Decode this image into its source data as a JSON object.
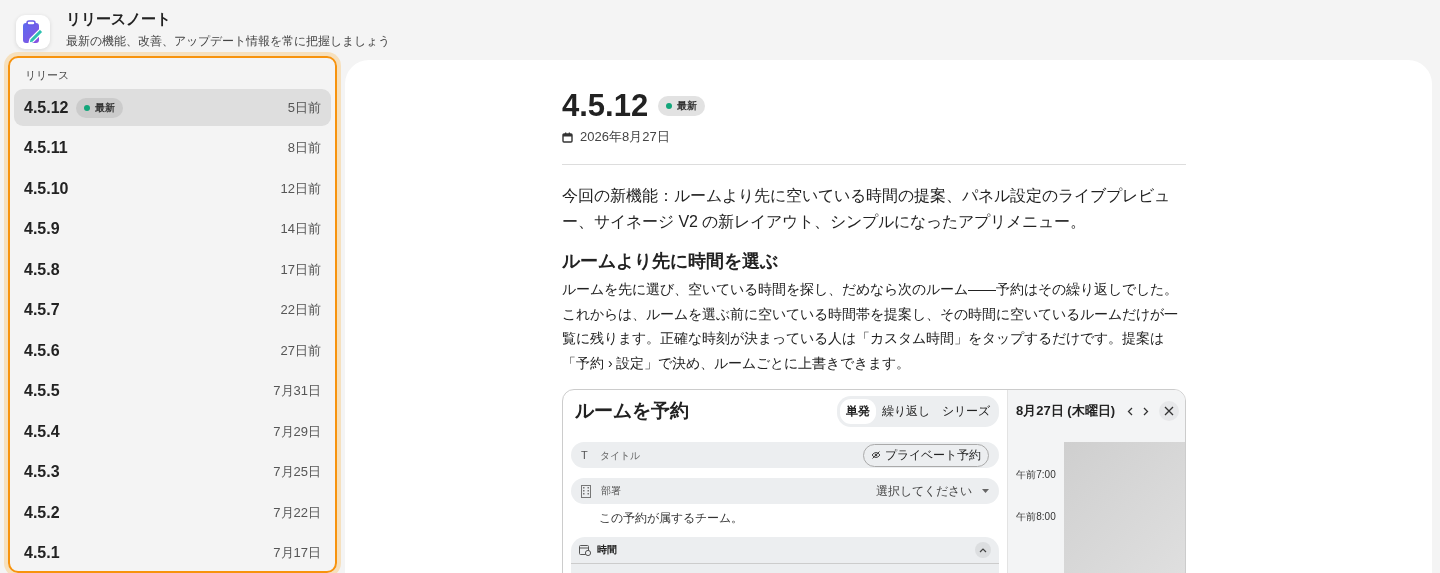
{
  "app": {
    "title": "リリースノート",
    "subtitle": "最新の機能、改善、アップデート情報を常に把握しましょう"
  },
  "sidebar": {
    "heading": "リリース",
    "releases": [
      {
        "version": "4.5.12",
        "badge": "最新",
        "date": "5日前",
        "selected": true
      },
      {
        "version": "4.5.11",
        "date": "8日前",
        "selected": false
      },
      {
        "version": "4.5.10",
        "date": "12日前",
        "selected": false
      },
      {
        "version": "4.5.9",
        "date": "14日前",
        "selected": false
      },
      {
        "version": "4.5.8",
        "date": "17日前",
        "selected": false
      },
      {
        "version": "4.5.7",
        "date": "22日前",
        "selected": false
      },
      {
        "version": "4.5.6",
        "date": "27日前",
        "selected": false
      },
      {
        "version": "4.5.5",
        "date": "7月31日",
        "selected": false
      },
      {
        "version": "4.5.4",
        "date": "7月29日",
        "selected": false
      },
      {
        "version": "4.5.3",
        "date": "7月25日",
        "selected": false
      },
      {
        "version": "4.5.2",
        "date": "7月22日",
        "selected": false
      },
      {
        "version": "4.5.1",
        "date": "7月17日",
        "selected": false
      }
    ]
  },
  "article": {
    "version": "4.5.12",
    "badge": "最新",
    "date": "2026年8月27日",
    "intro": "今回の新機能：ルームより先に空いている時間の提案、パネル設定のライブプレビュー、サイネージ V2 の新レイアウト、シンプルになったアプリメニュー。",
    "sections": [
      {
        "heading": "ルームより先に時間を選ぶ",
        "body": "ルームを先に選び、空いている時間を探し、だめなら次のルーム——予約はその繰り返しでした。これからは、ルームを選ぶ前に空いている時間帯を提案し、その時間に空いているルームだけが一覧に残ります。正確な時刻が決まっている人は「カスタム時間」をタップするだけです。提案は「予約 › 設定」で決め、ルームごとに上書きできます。"
      }
    ],
    "screenshot": {
      "title": "ルームを予約",
      "segments": [
        {
          "label": "単発",
          "selected": true
        },
        {
          "label": "繰り返し",
          "selected": false
        },
        {
          "label": "シリーズ",
          "selected": false
        }
      ],
      "title_field": {
        "icon": "T",
        "placeholder": "タイトル"
      },
      "private_button": "プライベート予約",
      "department": {
        "label": "部署",
        "value": "選択してください"
      },
      "department_hint": "この予約が属するチーム。",
      "time_section": {
        "label": "時間",
        "expanded": true
      },
      "calendar": {
        "date": "8月27日 (木曜日)",
        "time_labels": [
          "午前7:00",
          "午前8:00"
        ]
      }
    }
  }
}
